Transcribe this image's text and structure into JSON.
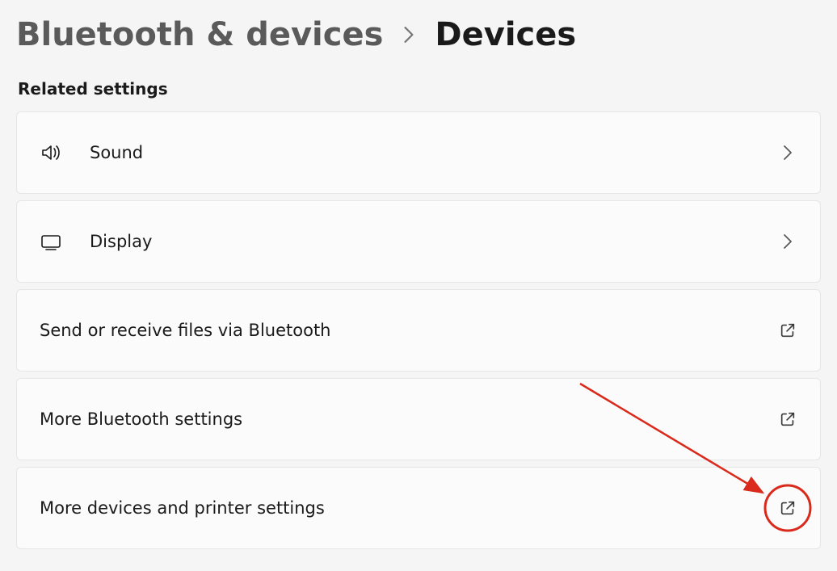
{
  "breadcrumb": {
    "parent": "Bluetooth & devices",
    "current": "Devices"
  },
  "section_heading": "Related settings",
  "items": [
    {
      "icon": "sound-icon",
      "label": "Sound",
      "trail": "chevron"
    },
    {
      "icon": "display-icon",
      "label": "Display",
      "trail": "chevron"
    },
    {
      "icon": null,
      "label": "Send or receive files via Bluetooth",
      "trail": "external"
    },
    {
      "icon": null,
      "label": "More Bluetooth settings",
      "trail": "external"
    },
    {
      "icon": null,
      "label": "More devices and printer settings",
      "trail": "external"
    }
  ],
  "annotation": {
    "circle_color": "#d92a1c",
    "arrow_color": "#d92a1c"
  }
}
